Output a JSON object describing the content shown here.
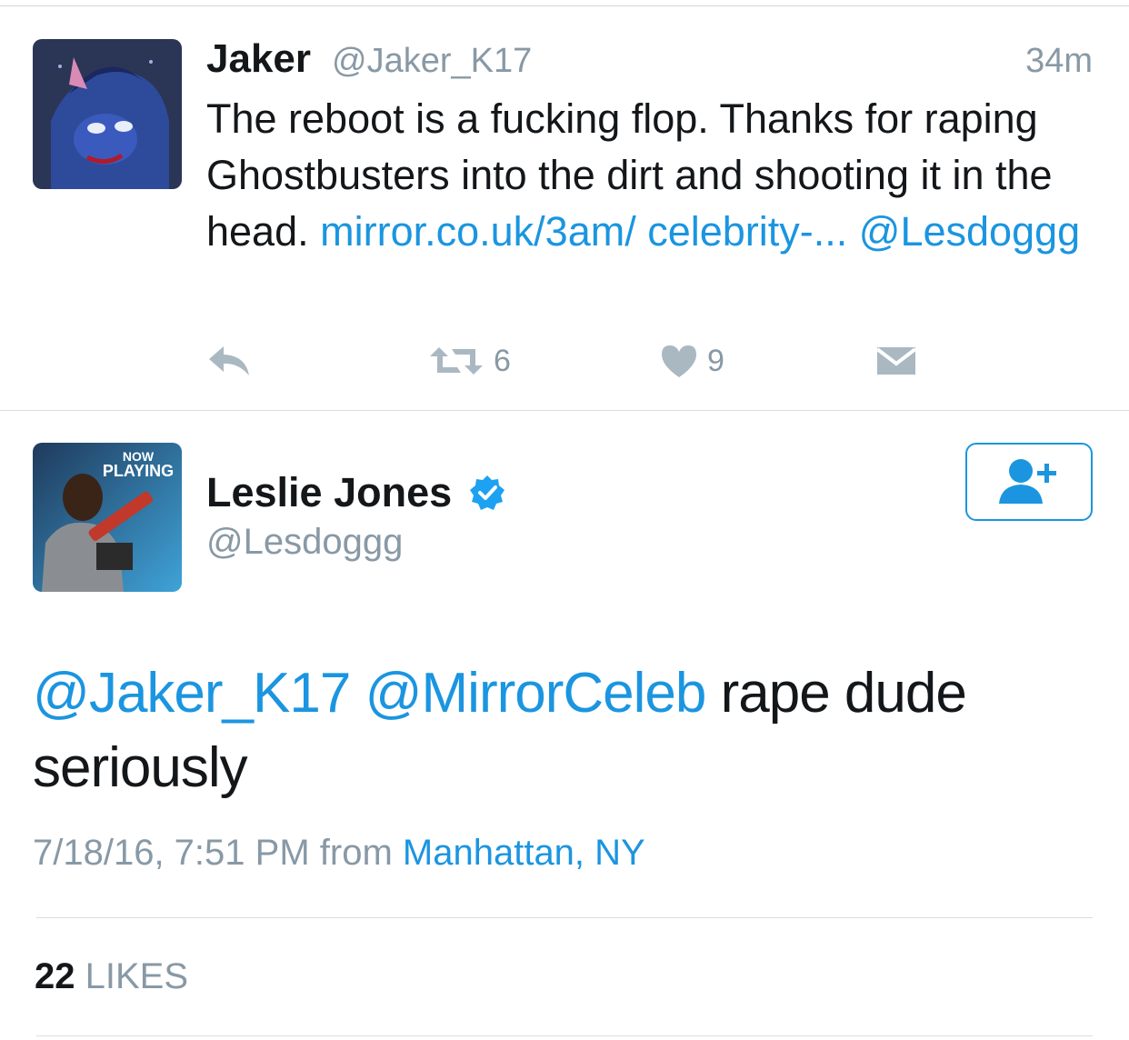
{
  "reply_tweet": {
    "display_name": "Jaker",
    "handle": "@Jaker_K17",
    "time": "34m",
    "text_plain": "The reboot is a fucking flop. Thanks for raping Ghostbusters into the dirt and shooting it in the head. ",
    "link_text": "mirror.co.uk/3am/ celebrity-...",
    "mention": "@Lesdoggg",
    "retweet_count": "6",
    "like_count": "9"
  },
  "main_tweet": {
    "display_name": "Leslie Jones",
    "handle": "@Lesdoggg",
    "avatar_badge_line1": "NOW",
    "avatar_badge_line2": "PLAYING",
    "mention1": "@Jaker_K17",
    "mention2": "@MirrorCeleb",
    "text_plain": " rape dude seriously",
    "timestamp": "7/18/16, 7:51 PM",
    "from_label": "from",
    "location": "Manhattan, NY",
    "likes_count": "22",
    "likes_label": "LIKES"
  },
  "icons": {
    "reply": "reply-icon",
    "retweet": "retweet-icon",
    "like": "heart-icon",
    "dm": "envelope-icon",
    "verified": "verified-badge-icon",
    "follow": "follow-user-icon"
  },
  "colors": {
    "link_blue": "#1b95e0",
    "muted_gray": "#8899a6",
    "text_dark": "#14171a",
    "verified_blue": "#1da1f2"
  }
}
